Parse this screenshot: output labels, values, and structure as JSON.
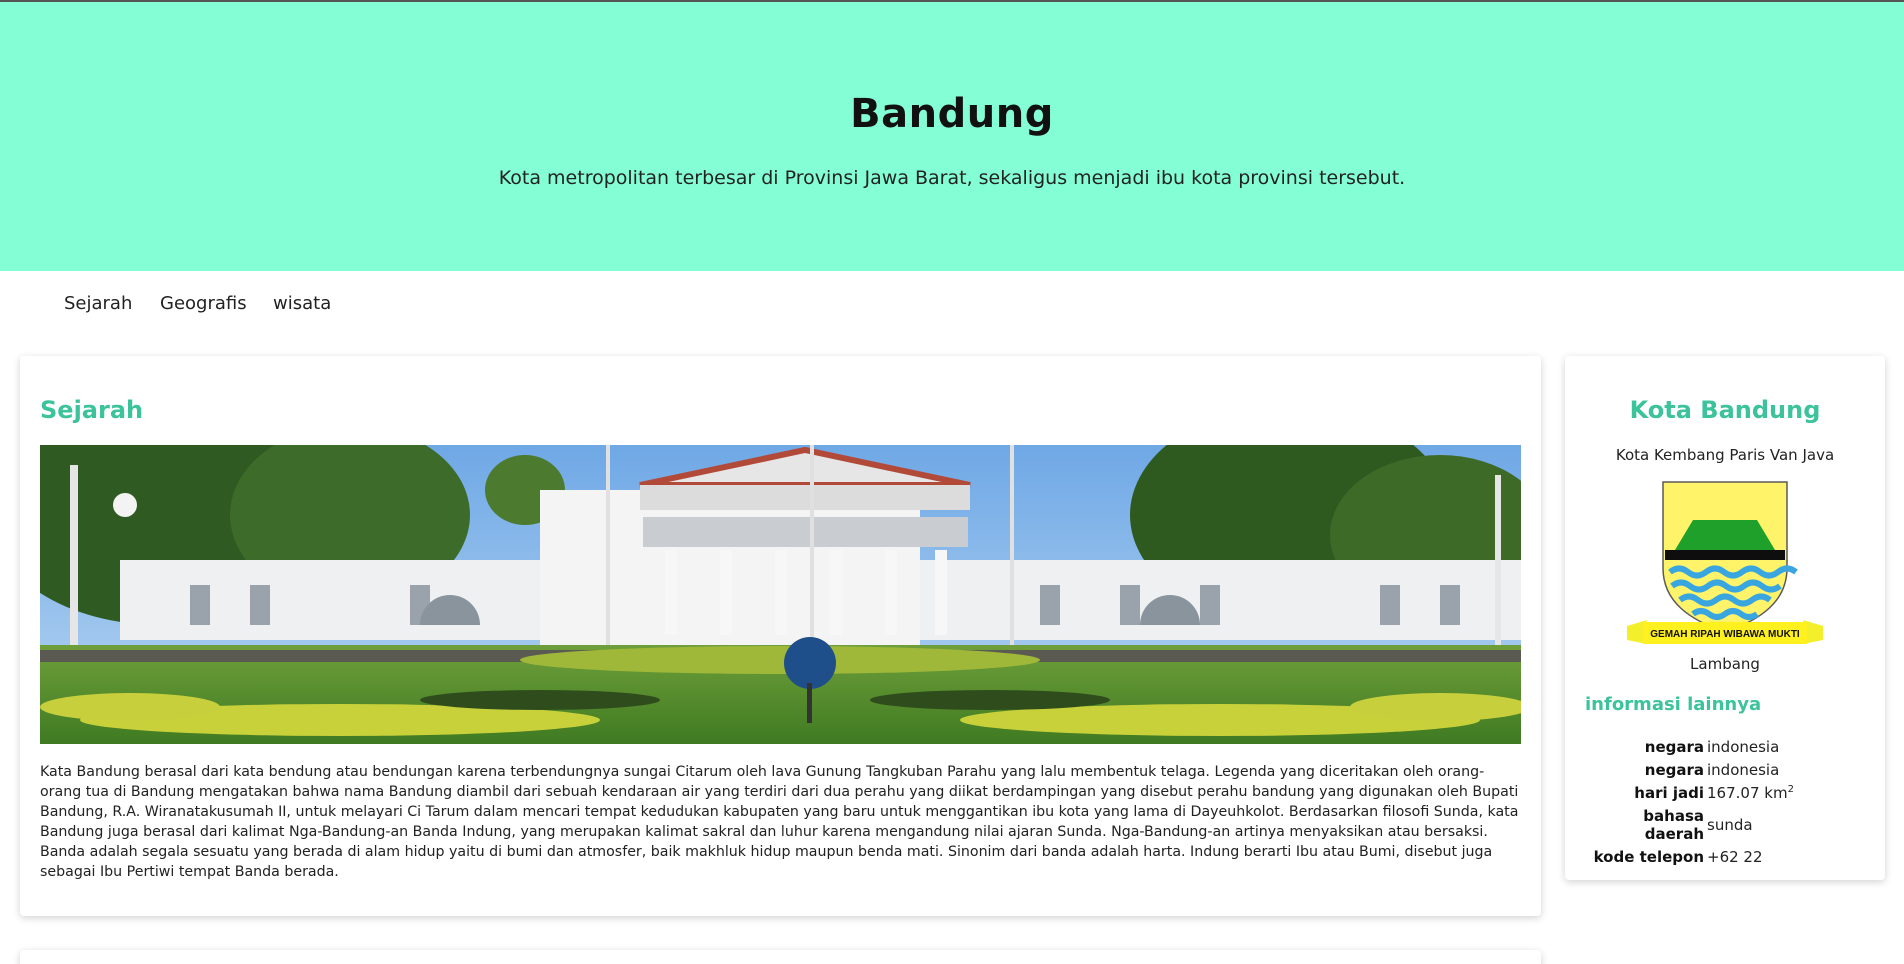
{
  "header": {
    "title": "Bandung",
    "tagline": "Kota metropolitan terbesar di Provinsi Jawa Barat, sekaligus menjadi ibu kota provinsi tersebut."
  },
  "nav": {
    "items": [
      {
        "label": "Sejarah"
      },
      {
        "label": "Geografis"
      },
      {
        "label": "wisata"
      }
    ]
  },
  "main": {
    "section_title": "Sejarah",
    "paragraph": "Kata Bandung berasal dari kata bendung atau bendungan karena terbendungnya sungai Citarum oleh lava Gunung Tangkuban Parahu yang lalu membentuk telaga. Legenda yang diceritakan oleh orang-orang tua di Bandung mengatakan bahwa nama Bandung diambil dari sebuah kendaraan air yang terdiri dari dua perahu yang diikat berdampingan yang disebut perahu bandung yang digunakan oleh Bupati Bandung, R.A. Wiranatakusumah II, untuk melayari Ci Tarum dalam mencari tempat kedudukan kabupaten yang baru untuk menggantikan ibu kota yang lama di Dayeuhkolot. Berdasarkan filosofi Sunda, kata Bandung juga berasal dari kalimat Nga-Bandung-an Banda Indung, yang merupakan kalimat sakral dan luhur karena mengandung nilai ajaran Sunda. Nga-Bandung-an artinya menyaksikan atau bersaksi. Banda adalah segala sesuatu yang berada di alam hidup yaitu di bumi dan atmosfer, baik makhluk hidup maupun benda mati. Sinonim dari banda adalah harta. Indung berarti Ibu atau Bumi, disebut juga sebagai Ibu Pertiwi tempat Banda berada."
  },
  "sidebar": {
    "title": "Kota Bandung",
    "subtitle": "Kota Kembang Paris Van Java",
    "emblem_motto": "GEMAH RIPAH WIBAWA MUKTI",
    "emblem_caption": "Lambang",
    "info_heading": "informasi lainnya",
    "info": [
      {
        "key": "negara",
        "value": "indonesia"
      },
      {
        "key": "negara",
        "value": "indonesia"
      },
      {
        "key": "hari jadi",
        "value": "167.07 km",
        "sup": "2"
      },
      {
        "key": "bahasa daerah",
        "value": "sunda"
      },
      {
        "key": "kode telepon",
        "value": "+62 22"
      }
    ]
  },
  "colors": {
    "header_bg": "#84ffd5",
    "accent": "#3cc39b"
  }
}
